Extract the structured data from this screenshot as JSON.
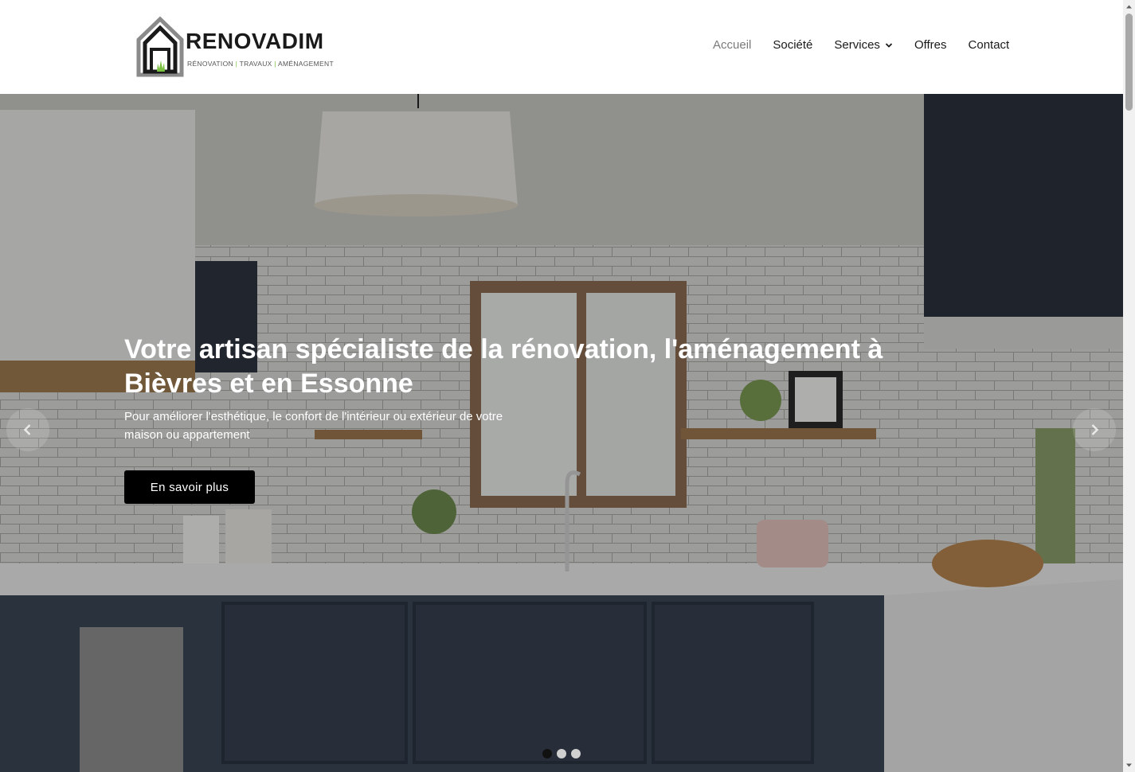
{
  "brand": {
    "name": "RENOVADIM",
    "tagline_parts": [
      "RÉNOVATION",
      "TRAVAUX",
      "AMÉNAGEMENT"
    ],
    "accent_color": "#7bc142"
  },
  "nav": {
    "items": [
      {
        "label": "Accueil",
        "active": true
      },
      {
        "label": "Société"
      },
      {
        "label": "Services",
        "has_dropdown": true
      },
      {
        "label": "Offres"
      },
      {
        "label": "Contact"
      }
    ]
  },
  "hero": {
    "title": "Votre artisan spécialiste de la rénovation, l'aménagement à Bièvres et en Essonne",
    "subtitle": "Pour améliorer l'esthétique, le confort de l'intérieur ou extérieur de votre maison ou appartement",
    "cta_label": "En savoir plus",
    "slides_count": 3,
    "active_slide": 1
  },
  "icons": {
    "prev": "chevron-left-icon",
    "next": "chevron-right-icon",
    "dropdown": "chevron-down-icon"
  }
}
